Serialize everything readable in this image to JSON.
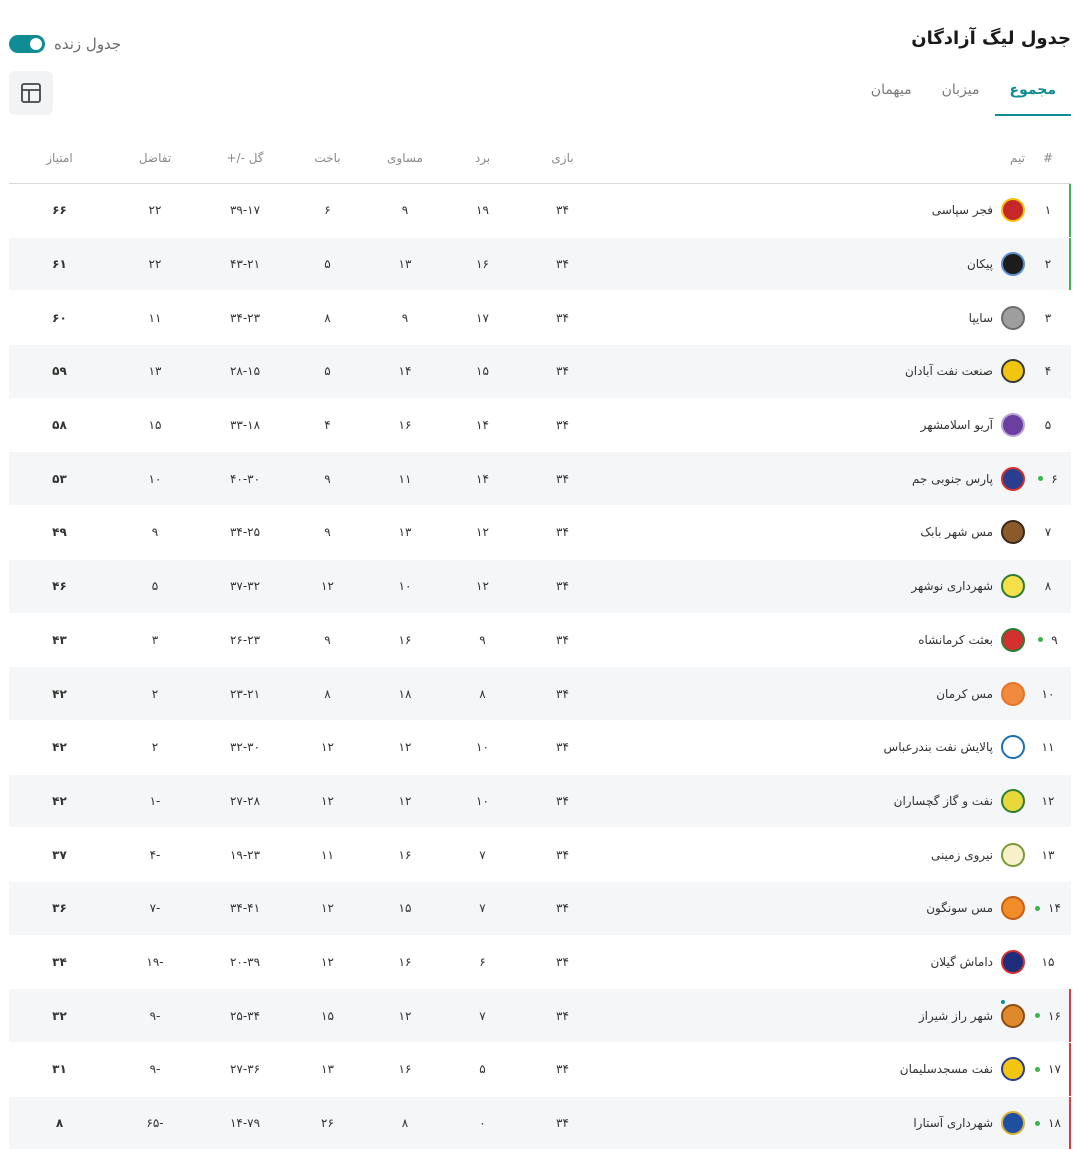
{
  "title": "جدول لیگ آزادگان",
  "live_toggle": {
    "label": "جدول زنده",
    "on": true
  },
  "accent_color": "#0f8c94",
  "tabs": [
    {
      "label": "مجموع",
      "active": true
    },
    {
      "label": "میزبان",
      "active": false
    },
    {
      "label": "میهمان",
      "active": false
    }
  ],
  "view_icon": "table-layout-icon",
  "columns": {
    "rank": "#",
    "team": "تیم",
    "played": "بازی",
    "won": "برد",
    "drawn": "مساوی",
    "lost": "باخت",
    "goals": "گل -/+",
    "diff": "تفاضل",
    "points": "امتیاز"
  },
  "rows": [
    {
      "rank": "۱",
      "team": "فجر سپاسی",
      "played": "۳۴",
      "won": "۱۹",
      "drawn": "۹",
      "lost": "۶",
      "goals": "۳۹-۱۷",
      "diff": "۲۲",
      "points": "۶۶",
      "zone": "promotion",
      "live_dot": false,
      "logo_dot": false,
      "logo_bg": "#c62828",
      "logo_ring": "#f4c20d"
    },
    {
      "rank": "۲",
      "team": "پیکان",
      "played": "۳۴",
      "won": "۱۶",
      "drawn": "۱۳",
      "lost": "۵",
      "goals": "۴۳-۲۱",
      "diff": "۲۲",
      "points": "۶۱",
      "zone": "promotion",
      "live_dot": false,
      "logo_dot": false,
      "logo_bg": "#1c1c1c",
      "logo_ring": "#5b8bd0"
    },
    {
      "rank": "۳",
      "team": "سایپا",
      "played": "۳۴",
      "won": "۱۷",
      "drawn": "۹",
      "lost": "۸",
      "goals": "۳۴-۲۳",
      "diff": "۱۱",
      "points": "۶۰",
      "zone": "",
      "live_dot": false,
      "logo_dot": false,
      "logo_bg": "#9e9e9e",
      "logo_ring": "#6d6d6d"
    },
    {
      "rank": "۴",
      "team": "صنعت نفت آبادان",
      "played": "۳۴",
      "won": "۱۵",
      "drawn": "۱۴",
      "lost": "۵",
      "goals": "۲۸-۱۵",
      "diff": "۱۳",
      "points": "۵۹",
      "zone": "",
      "live_dot": false,
      "logo_dot": false,
      "logo_bg": "#f2c511",
      "logo_ring": "#3a3a3a"
    },
    {
      "rank": "۵",
      "team": "آریو اسلامشهر",
      "played": "۳۴",
      "won": "۱۴",
      "drawn": "۱۶",
      "lost": "۴",
      "goals": "۳۳-۱۸",
      "diff": "۱۵",
      "points": "۵۸",
      "zone": "",
      "live_dot": false,
      "logo_dot": false,
      "logo_bg": "#6a3fa0",
      "logo_ring": "#b9a3d6"
    },
    {
      "rank": "۶",
      "team": "پارس جنوبی جم",
      "played": "۳۴",
      "won": "۱۴",
      "drawn": "۱۱",
      "lost": "۹",
      "goals": "۴۰-۳۰",
      "diff": "۱۰",
      "points": "۵۳",
      "zone": "",
      "live_dot": true,
      "logo_dot": false,
      "logo_bg": "#2a3e8f",
      "logo_ring": "#d32f2f"
    },
    {
      "rank": "۷",
      "team": "مس شهر بابک",
      "played": "۳۴",
      "won": "۱۲",
      "drawn": "۱۳",
      "lost": "۹",
      "goals": "۳۴-۲۵",
      "diff": "۹",
      "points": "۴۹",
      "zone": "",
      "live_dot": false,
      "logo_dot": false,
      "logo_bg": "#8a5a2b",
      "logo_ring": "#3a2a1a"
    },
    {
      "rank": "۸",
      "team": "شهرداری نوشهر",
      "played": "۳۴",
      "won": "۱۲",
      "drawn": "۱۰",
      "lost": "۱۲",
      "goals": "۳۷-۳۲",
      "diff": "۵",
      "points": "۴۶",
      "zone": "",
      "live_dot": false,
      "logo_dot": false,
      "logo_bg": "#f5e04a",
      "logo_ring": "#2e7d32"
    },
    {
      "rank": "۹",
      "team": "بعثت کرمانشاه",
      "played": "۳۴",
      "won": "۹",
      "drawn": "۱۶",
      "lost": "۹",
      "goals": "۲۶-۲۳",
      "diff": "۳",
      "points": "۴۳",
      "zone": "",
      "live_dot": true,
      "logo_dot": false,
      "logo_bg": "#d32f2f",
      "logo_ring": "#2e7d32"
    },
    {
      "rank": "۱۰",
      "team": "مس کرمان",
      "played": "۳۴",
      "won": "۸",
      "drawn": "۱۸",
      "lost": "۸",
      "goals": "۲۳-۲۱",
      "diff": "۲",
      "points": "۴۲",
      "zone": "",
      "live_dot": false,
      "logo_dot": false,
      "logo_bg": "#f08a3c",
      "logo_ring": "#e8732a"
    },
    {
      "rank": "۱۱",
      "team": "پالایش نفت بندرعباس",
      "played": "۳۴",
      "won": "۱۰",
      "drawn": "۱۲",
      "lost": "۱۲",
      "goals": "۳۲-۳۰",
      "diff": "۲",
      "points": "۴۲",
      "zone": "",
      "live_dot": false,
      "logo_dot": false,
      "logo_bg": "#ffffff",
      "logo_ring": "#1a6fb5"
    },
    {
      "rank": "۱۲",
      "team": "نفت و گاز گچساران",
      "played": "۳۴",
      "won": "۱۰",
      "drawn": "۱۲",
      "lost": "۱۲",
      "goals": "۲۷-۲۸",
      "diff": "-۱",
      "points": "۴۲",
      "zone": "",
      "live_dot": false,
      "logo_dot": false,
      "logo_bg": "#e8d83a",
      "logo_ring": "#2e7d32"
    },
    {
      "rank": "۱۳",
      "team": "نیروی زمینی",
      "played": "۳۴",
      "won": "۷",
      "drawn": "۱۶",
      "lost": "۱۱",
      "goals": "۱۹-۲۳",
      "diff": "-۴",
      "points": "۳۷",
      "zone": "",
      "live_dot": false,
      "logo_dot": false,
      "logo_bg": "#f7f0c8",
      "logo_ring": "#7a9a3a"
    },
    {
      "rank": "۱۴",
      "team": "مس سونگون",
      "played": "۳۴",
      "won": "۷",
      "drawn": "۱۵",
      "lost": "۱۲",
      "goals": "۳۴-۴۱",
      "diff": "-۷",
      "points": "۳۶",
      "zone": "",
      "live_dot": true,
      "logo_dot": false,
      "logo_bg": "#f28c28",
      "logo_ring": "#c65f12"
    },
    {
      "rank": "۱۵",
      "team": "داماش گیلان",
      "played": "۳۴",
      "won": "۶",
      "drawn": "۱۶",
      "lost": "۱۲",
      "goals": "۲۰-۳۹",
      "diff": "-۱۹",
      "points": "۳۴",
      "zone": "",
      "live_dot": false,
      "logo_dot": false,
      "logo_bg": "#1f2d7a",
      "logo_ring": "#d32f2f"
    },
    {
      "rank": "۱۶",
      "team": "شهر راز شیراز",
      "played": "۳۴",
      "won": "۷",
      "drawn": "۱۲",
      "lost": "۱۵",
      "goals": "۲۵-۳۴",
      "diff": "-۹",
      "points": "۳۲",
      "zone": "relegation",
      "live_dot": true,
      "logo_dot": true,
      "logo_bg": "#e0892a",
      "logo_ring": "#8a4d12"
    },
    {
      "rank": "۱۷",
      "team": "نفت مسجدسلیمان",
      "played": "۳۴",
      "won": "۵",
      "drawn": "۱۶",
      "lost": "۱۳",
      "goals": "۲۷-۳۶",
      "diff": "-۹",
      "points": "۳۱",
      "zone": "relegation",
      "live_dot": true,
      "logo_dot": false,
      "logo_bg": "#f2c511",
      "logo_ring": "#2a3e8f"
    },
    {
      "rank": "۱۸",
      "team": "شهرداری آستارا",
      "played": "۳۴",
      "won": "۰",
      "drawn": "۸",
      "lost": "۲۶",
      "goals": "۱۴-۷۹",
      "diff": "-۶۵",
      "points": "۸",
      "zone": "relegation",
      "live_dot": true,
      "logo_dot": false,
      "logo_bg": "#1e4fa0",
      "logo_ring": "#d9b13a"
    }
  ]
}
